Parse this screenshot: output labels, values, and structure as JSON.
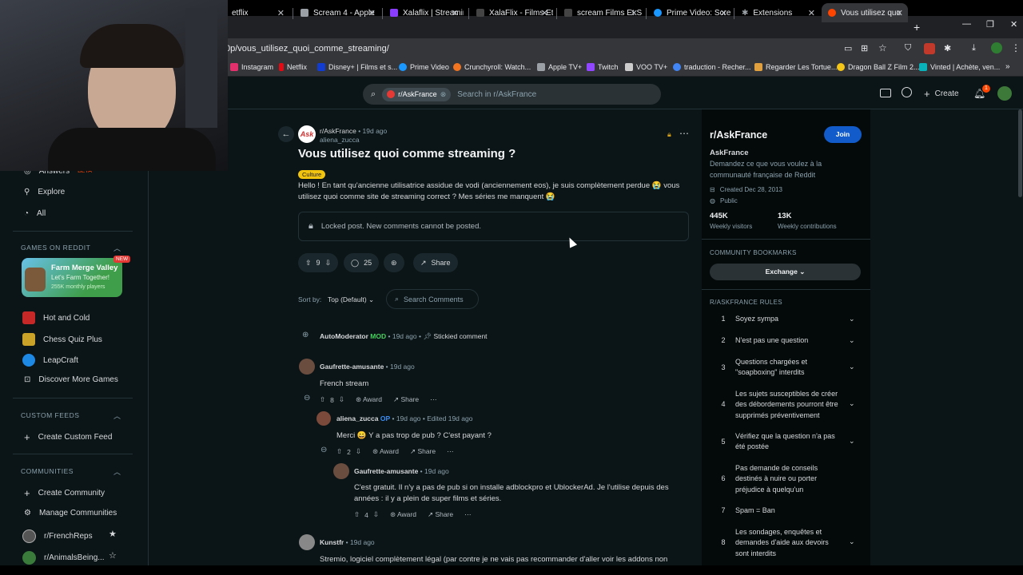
{
  "browser": {
    "tabs": [
      {
        "label": "etflix",
        "color": "#e50914"
      },
      {
        "label": "Scream 4 - Apple",
        "color": "#9aa0a6"
      },
      {
        "label": "Xalaflix | Streamin",
        "color": "#8b3dff"
      },
      {
        "label": "XalaFlix - Films Et",
        "color": "#444444"
      },
      {
        "label": "scream Films Et S",
        "color": "#444444"
      },
      {
        "label": "Prime Video: Scre",
        "color": "#1a98ff"
      },
      {
        "label": "Extensions",
        "color": "#9aa0a6"
      },
      {
        "label": "Vous utilisez quo",
        "color": "#ff4500"
      }
    ],
    "url": "0p/vous_utilisez_quoi_comme_streaming/",
    "bookmarks": [
      {
        "label": "Instagram",
        "color": "#e1306c"
      },
      {
        "label": "Netflix",
        "color": "#e50914"
      },
      {
        "label": "Disney+ | Films et s...",
        "color": "#113ccf"
      },
      {
        "label": "Prime Video",
        "color": "#1a98ff"
      },
      {
        "label": "Crunchyroll: Watch...",
        "color": "#f47521"
      },
      {
        "label": "Apple TV+",
        "color": "#9aa0a6"
      },
      {
        "label": "Twitch",
        "color": "#9146ff"
      },
      {
        "label": "VOO TV+",
        "color": "#cccccc"
      },
      {
        "label": "traduction - Recher...",
        "color": "#4285f4"
      },
      {
        "label": "Regarder Les Tortue...",
        "color": "#e0a040"
      },
      {
        "label": "Dragon Ball Z Film 2...",
        "color": "#f5c518"
      },
      {
        "label": "Vinted | Achète, ven...",
        "color": "#09b1ba"
      }
    ]
  },
  "header": {
    "search_chip": "r/AskFrance",
    "search_placeholder": "Search in r/AskFrance",
    "create_label": "Create",
    "notif_count": "1"
  },
  "leftnav": {
    "answers_label": "Answers",
    "answers_badge": "BETA",
    "explore_label": "Explore",
    "all_label": "All",
    "games_header": "GAMES ON REDDIT",
    "featured_game": {
      "title": "Farm Merge Valley",
      "subtitle": "Let's Farm Together!",
      "players": "255K monthly players",
      "badge": "NEW"
    },
    "games": [
      "Hot and Cold",
      "Chess Quiz Plus",
      "LeapCraft",
      "Discover More Games"
    ],
    "custom_feeds_header": "CUSTOM FEEDS",
    "create_custom_feed": "Create Custom Feed",
    "communities_header": "COMMUNITIES",
    "create_community": "Create Community",
    "manage_communities": "Manage Communities",
    "communities": [
      "r/FrenchReps",
      "r/AnimalsBeing..."
    ]
  },
  "post": {
    "subreddit": "r/AskFrance",
    "age": "19d ago",
    "author": "aliena_zucca",
    "title": "Vous utilisez quoi comme streaming ?",
    "flair": "Culture",
    "body": "Hello ! En tant qu'ancienne utilisatrice assidue de vodi (anciennement eos), je suis complètement perdue 😭 vous utilisez quoi comme site de streaming correct ? Mes séries me manquent 😭",
    "locked_notice": "Locked post. New comments cannot be posted.",
    "votes": "9",
    "comments": "25",
    "share_label": "Share",
    "sort_label": "Sort by:",
    "sort_value": "Top (Default)",
    "search_comments": "Search Comments"
  },
  "comments": {
    "automod": {
      "author": "AutoModerator",
      "mod": "MOD",
      "age": "19d ago",
      "stickied": "Stickied comment"
    },
    "c1": {
      "author": "Gaufrette-amusante",
      "age": "19d ago",
      "text": "French stream",
      "votes": "8",
      "award": "Award",
      "share": "Share"
    },
    "c2": {
      "author": "aliena_zucca",
      "op": "OP",
      "age": "19d ago",
      "edited": "Edited 19d ago",
      "text": "Merci 😄 Y a pas trop de pub ? C'est payant ?",
      "votes": "2",
      "award": "Award",
      "share": "Share"
    },
    "c3": {
      "author": "Gaufrette-amusante",
      "age": "19d ago",
      "text1": "C'est gratuit. Il n'y a pas de pub si on installe adblockpro et UblockerAd. Je l'utilise depuis des",
      "text2": "années : il y a plein de super films et séries.",
      "votes": "4",
      "award": "Award",
      "share": "Share"
    },
    "c4": {
      "author": "Kunstfr",
      "age": "19d ago",
      "text": "Stremio, logiciel complètement légal (par contre je ne vais pas recommander d'aller voir les addons non"
    }
  },
  "sidebar": {
    "name": "r/AskFrance",
    "join_label": "Join",
    "display_name": "AskFrance",
    "description": "Demandez ce que vous voulez à la communauté française de Reddit",
    "created": "Created Dec 28, 2013",
    "visibility": "Public",
    "visitors_value": "445K",
    "visitors_label": "Weekly visitors",
    "contrib_value": "13K",
    "contrib_label": "Weekly contributions",
    "bookmarks_header": "COMMUNITY BOOKMARKS",
    "exchange_label": "Exchange",
    "rules_header": "R/ASKFRANCE RULES",
    "rules": [
      {
        "num": "1",
        "text": "Soyez sympa"
      },
      {
        "num": "2",
        "text": "N'est pas une question"
      },
      {
        "num": "3",
        "text": "Questions chargées et \"soapboxing\" interdits"
      },
      {
        "num": "4",
        "text": "Les sujets susceptibles de créer des débordements pourront être supprimés préventivement"
      },
      {
        "num": "5",
        "text": "Vérifiez que la question n'a pas été postée"
      },
      {
        "num": "6",
        "text": "Pas demande de conseils destinés à nuire ou porter préjudice à quelqu'un"
      },
      {
        "num": "7",
        "text": "Spam = Ban"
      },
      {
        "num": "8",
        "text": "Les sondages, enquêtes et demandes d'aide aux devoirs sont interdits"
      }
    ]
  }
}
